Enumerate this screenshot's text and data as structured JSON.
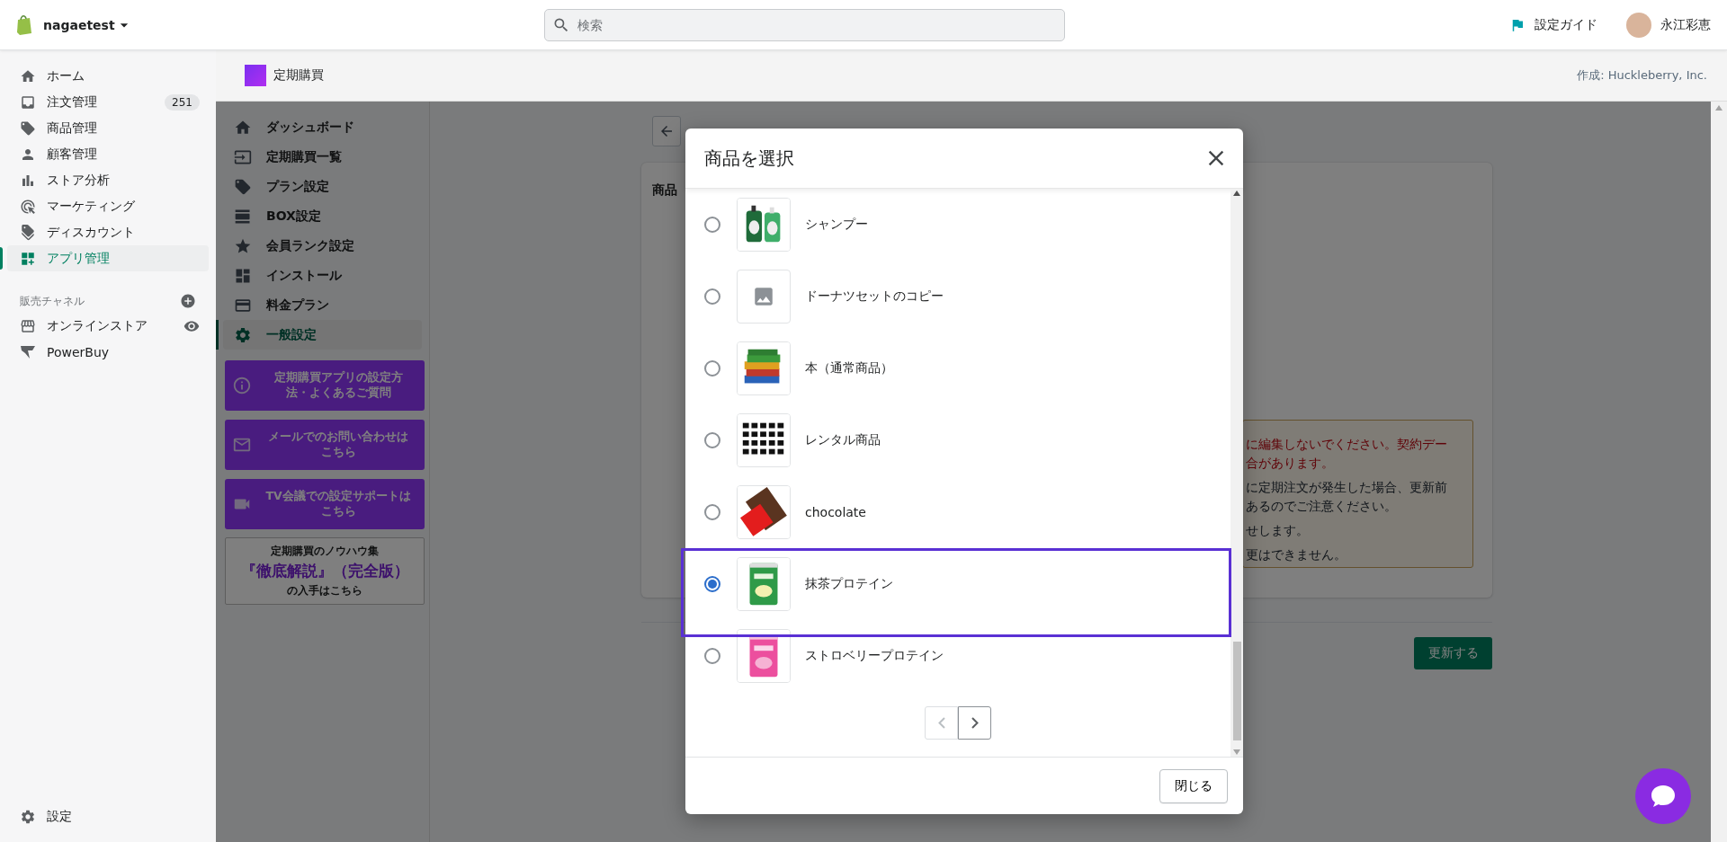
{
  "topbar": {
    "store": "nagaetest",
    "search": {
      "placeholder": "検索"
    },
    "guide": "設定ガイド",
    "user": "永江彩恵"
  },
  "nav": {
    "items": [
      {
        "label": "ホーム",
        "selected": false
      },
      {
        "label": "注文管理",
        "selected": false,
        "badge": "251"
      },
      {
        "label": "商品管理",
        "selected": false
      },
      {
        "label": "顧客管理",
        "selected": false
      },
      {
        "label": "ストア分析",
        "selected": false
      },
      {
        "label": "マーケティング",
        "selected": false
      },
      {
        "label": "ディスカウント",
        "selected": false
      },
      {
        "label": "アプリ管理",
        "selected": true
      }
    ],
    "channels_title": "販売チャネル",
    "channels": [
      {
        "label": "オンラインストア"
      },
      {
        "label": "PowerBuy"
      }
    ],
    "settings": "設定"
  },
  "app_header": {
    "name": "定期購買",
    "author": "作成: Huckleberry, Inc."
  },
  "app_menu": {
    "items": [
      {
        "label": "ダッシュボード",
        "selected": false
      },
      {
        "label": "定期購買一覧",
        "selected": false
      },
      {
        "label": "プラン設定",
        "selected": false
      },
      {
        "label": "BOX設定",
        "selected": false
      },
      {
        "label": "会員ランク設定",
        "selected": false
      },
      {
        "label": "インストール",
        "selected": false
      },
      {
        "label": "料金プラン",
        "selected": false
      },
      {
        "label": "一般設定",
        "selected": true
      }
    ],
    "help_buttons": [
      "定期購買アプリの設定方法・よくあるご質問",
      "メールでのお問い合わせはこちら",
      "TV会議での設定サポートはこちら"
    ],
    "knowhow": {
      "intro": "定期購買のノウハウ集",
      "title": "『徹底解説』（完全版）",
      "outro": "の入手はこちら"
    }
  },
  "content": {
    "section_label": "商品",
    "warnings": [
      {
        "kind": "alert",
        "lines": [
          "に編集しないでください。契約デー",
          "合があります。"
        ]
      },
      {
        "kind": "note",
        "lines": [
          "に定期注文が発生した場合、更新前",
          "あるのでご注意ください。"
        ]
      },
      {
        "kind": "note",
        "lines": [
          "せします。"
        ]
      },
      {
        "kind": "note",
        "lines": [
          "更はできません。"
        ]
      }
    ],
    "update_button": "更新する"
  },
  "modal": {
    "title": "商品を選択",
    "products": [
      {
        "name": "シャンプー",
        "selected": false,
        "highlighted": false,
        "kind": "picture"
      },
      {
        "name": "ドーナツセットのコピー",
        "selected": false,
        "highlighted": false,
        "kind": "placeholder"
      },
      {
        "name": "本（通常商品）",
        "selected": false,
        "highlighted": false,
        "kind": "picture"
      },
      {
        "name": "レンタル商品",
        "selected": false,
        "highlighted": false,
        "kind": "picture"
      },
      {
        "name": "chocolate",
        "selected": false,
        "highlighted": false,
        "kind": "picture"
      },
      {
        "name": "抹茶プロテイン",
        "selected": true,
        "highlighted": true,
        "kind": "picture"
      },
      {
        "name": "ストロベリープロテイン",
        "selected": false,
        "highlighted": false,
        "kind": "picture"
      }
    ],
    "pagination": {
      "previous": {
        "disabled": true
      },
      "next": {
        "disabled": false
      }
    },
    "close_button": "閉じる"
  }
}
